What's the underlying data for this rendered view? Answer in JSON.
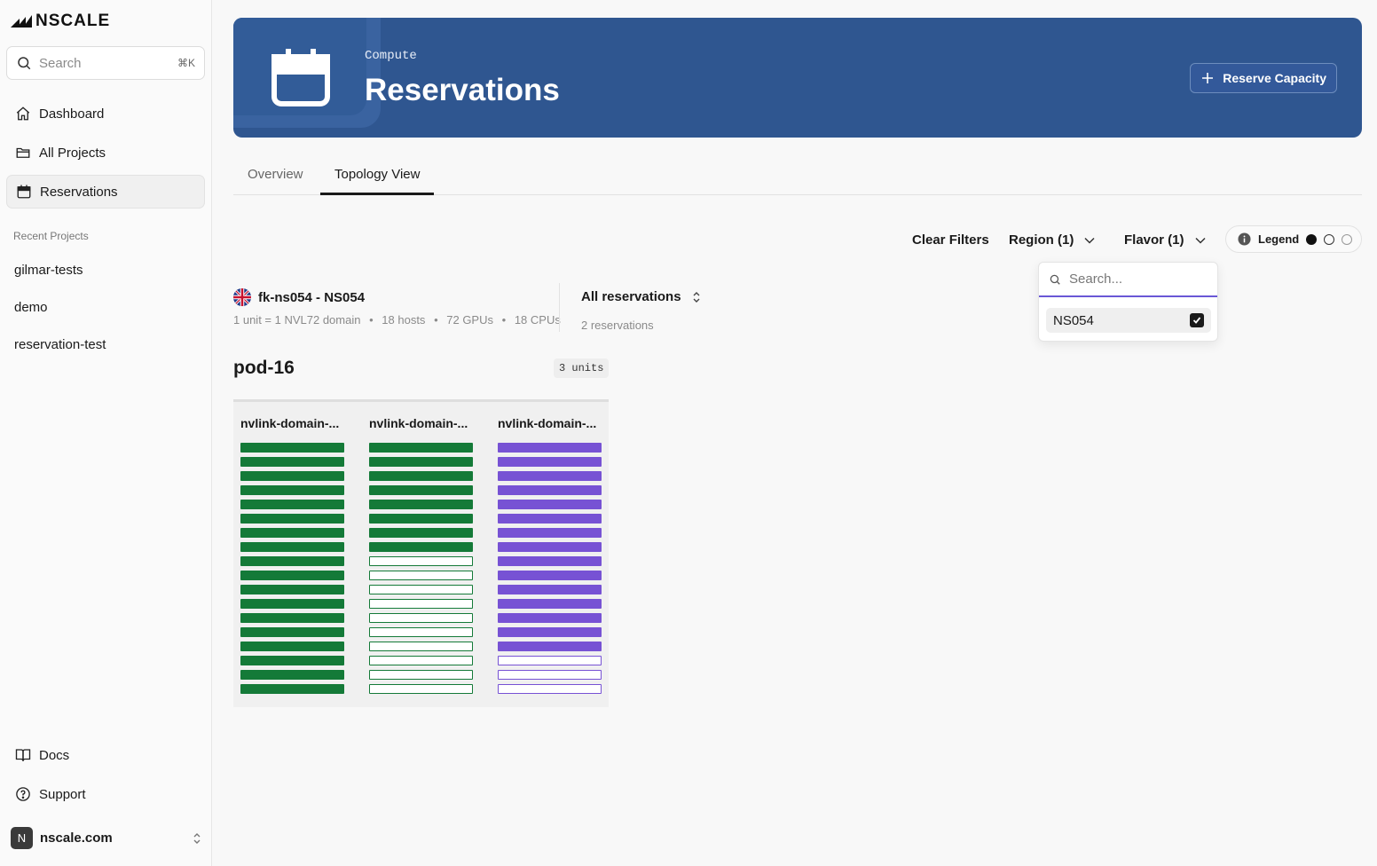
{
  "app": {
    "logo_text": "NSCALE",
    "search_placeholder": "Search",
    "search_shortcut": "⌘K"
  },
  "sidebar": {
    "nav": [
      {
        "label": "Dashboard",
        "icon": "home-icon"
      },
      {
        "label": "All Projects",
        "icon": "folder-icon"
      },
      {
        "label": "Reservations",
        "icon": "calendar-icon",
        "active": true
      }
    ],
    "recent_label": "Recent Projects",
    "recent": [
      "gilmar-tests",
      "demo",
      "reservation-test"
    ],
    "footer": [
      {
        "label": "Docs",
        "icon": "book-icon"
      },
      {
        "label": "Support",
        "icon": "help-circle-icon"
      }
    ],
    "org": {
      "initial": "N",
      "name": "nscale.com"
    }
  },
  "header": {
    "subtitle": "Compute",
    "title": "Reservations",
    "action_label": "Reserve Capacity",
    "banner_color": "#2f5690"
  },
  "tabs": [
    {
      "label": "Overview",
      "active": false
    },
    {
      "label": "Topology View",
      "active": true
    }
  ],
  "filters": {
    "clear_label": "Clear Filters",
    "region_label": "Region (1)",
    "flavor_label": "Flavor (1)",
    "legend_label": "Legend"
  },
  "region_dropdown": {
    "search_placeholder": "Search...",
    "options": [
      {
        "label": "NS054",
        "checked": true
      }
    ]
  },
  "site": {
    "name": "fk-ns054 - NS054",
    "meta": [
      "1 unit = 1 NVL72 domain",
      "18 hosts",
      "72 GPUs",
      "18 CPUs"
    ],
    "reservation_select": "All reservations",
    "reservation_count": "2 reservations"
  },
  "pod": {
    "name": "pod-16",
    "units_badge": "3 units",
    "domains": [
      {
        "name": "nvlink-domain-...",
        "color": "#147a38",
        "used": 18,
        "total": 18
      },
      {
        "name": "nvlink-domain-...",
        "color": "#147a38",
        "used": 8,
        "total": 18
      },
      {
        "name": "nvlink-domain-...",
        "color": "#7752d4",
        "used": 15,
        "total": 18
      }
    ]
  }
}
